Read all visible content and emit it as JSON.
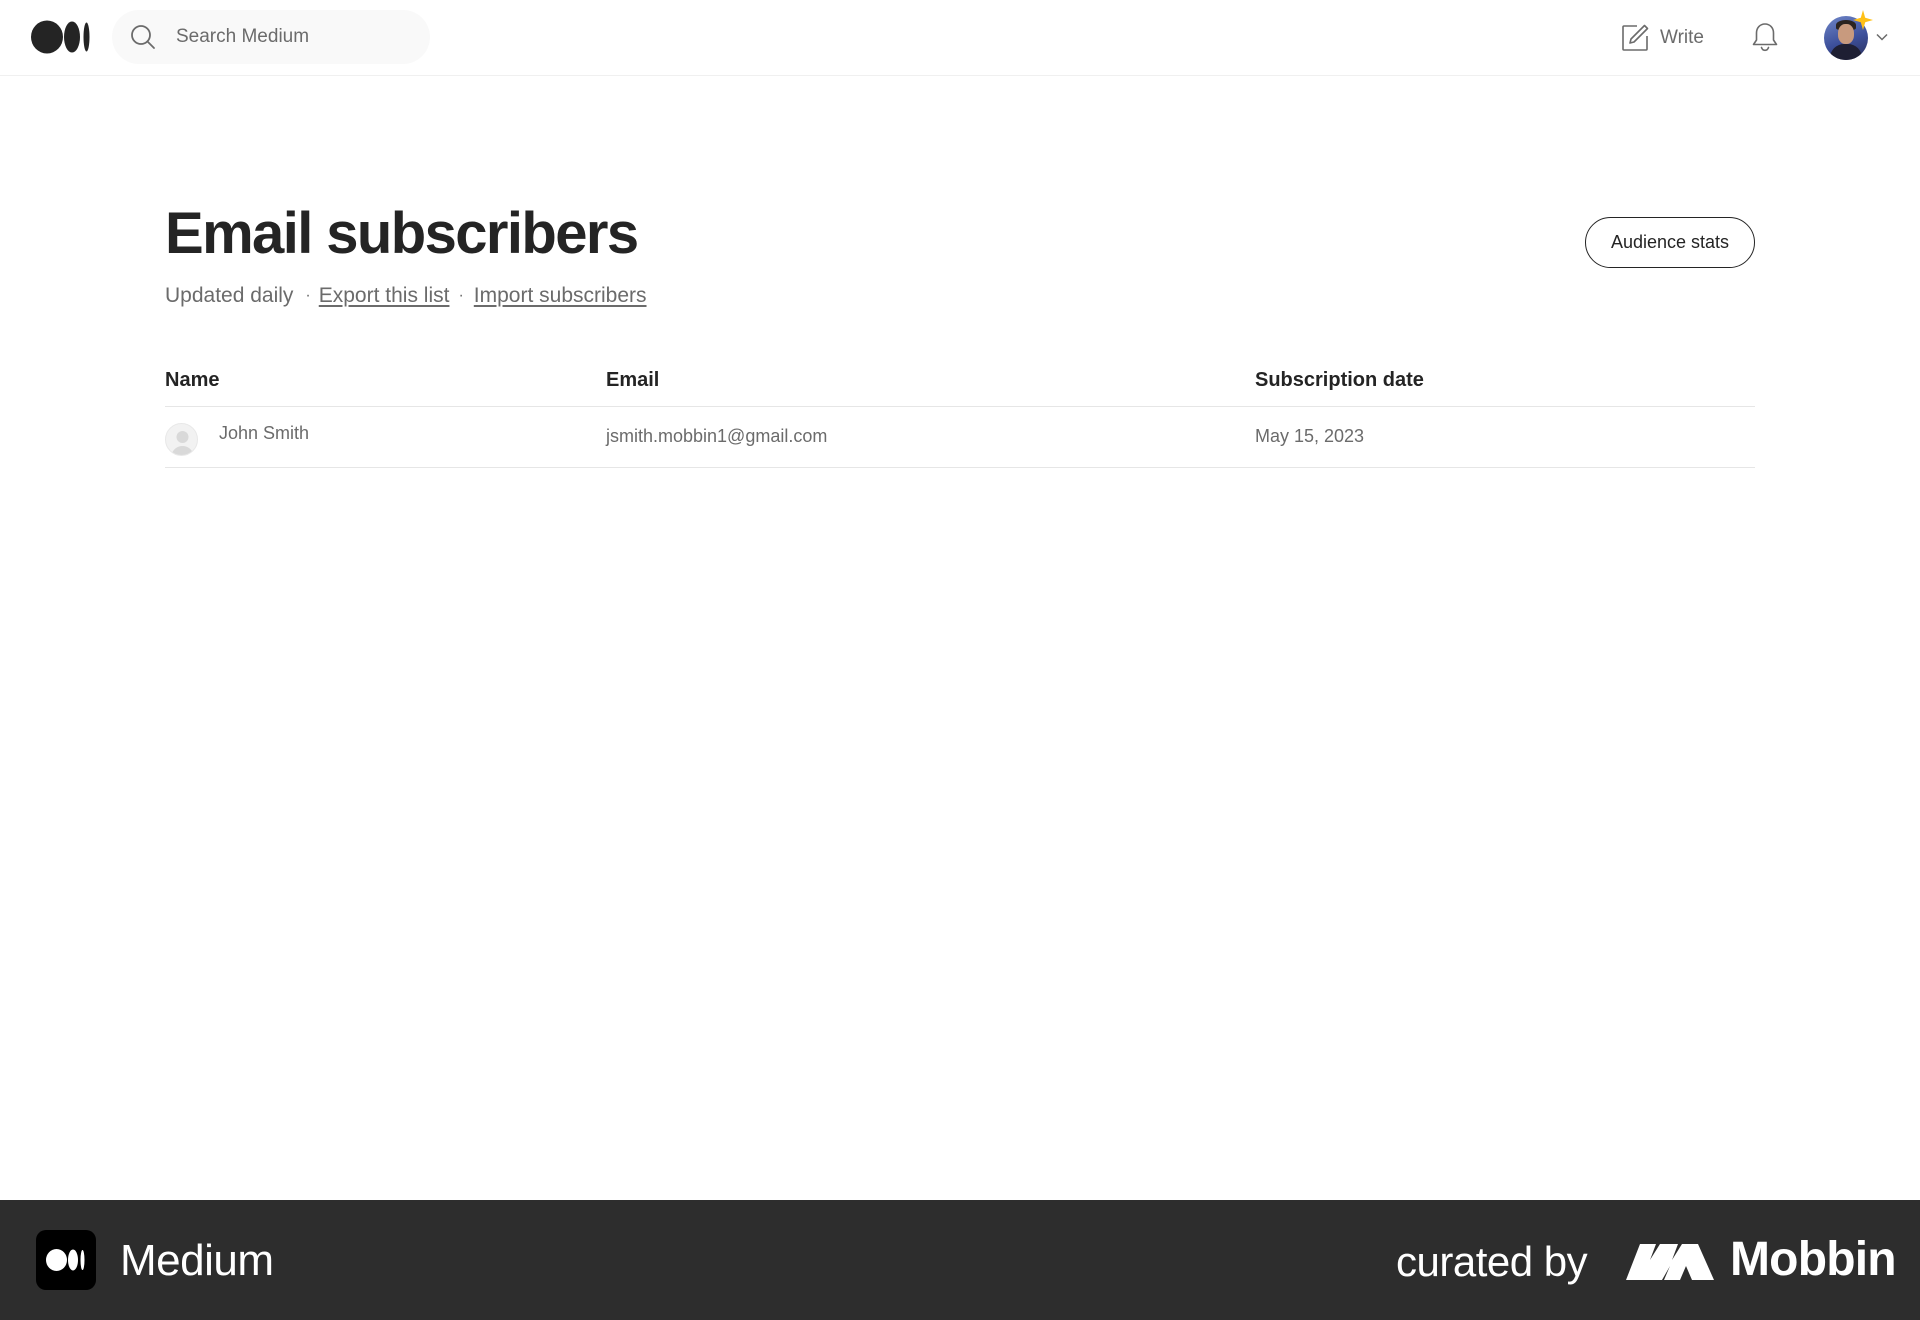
{
  "header": {
    "search": {
      "placeholder": "Search Medium",
      "value": ""
    },
    "write_label": "Write"
  },
  "page": {
    "title": "Email subscribers",
    "updated_text": "Updated daily",
    "separator": "·",
    "export_link": "Export this list",
    "import_link": "Import subscribers",
    "audience_button": "Audience stats"
  },
  "table": {
    "columns": [
      "Name",
      "Email",
      "Subscription date"
    ],
    "rows": [
      {
        "name": "John Smith",
        "email": "jsmith.mobbin1@gmail.com",
        "date": "May 15, 2023"
      }
    ]
  },
  "footer": {
    "brand": "Medium",
    "curated_by": "curated by",
    "curator": "Mobbin"
  },
  "colors": {
    "text_primary": "#242424",
    "text_secondary": "#6b6b6b",
    "footer_bg": "#2d2d2d",
    "sparkle": "#ffc017"
  }
}
